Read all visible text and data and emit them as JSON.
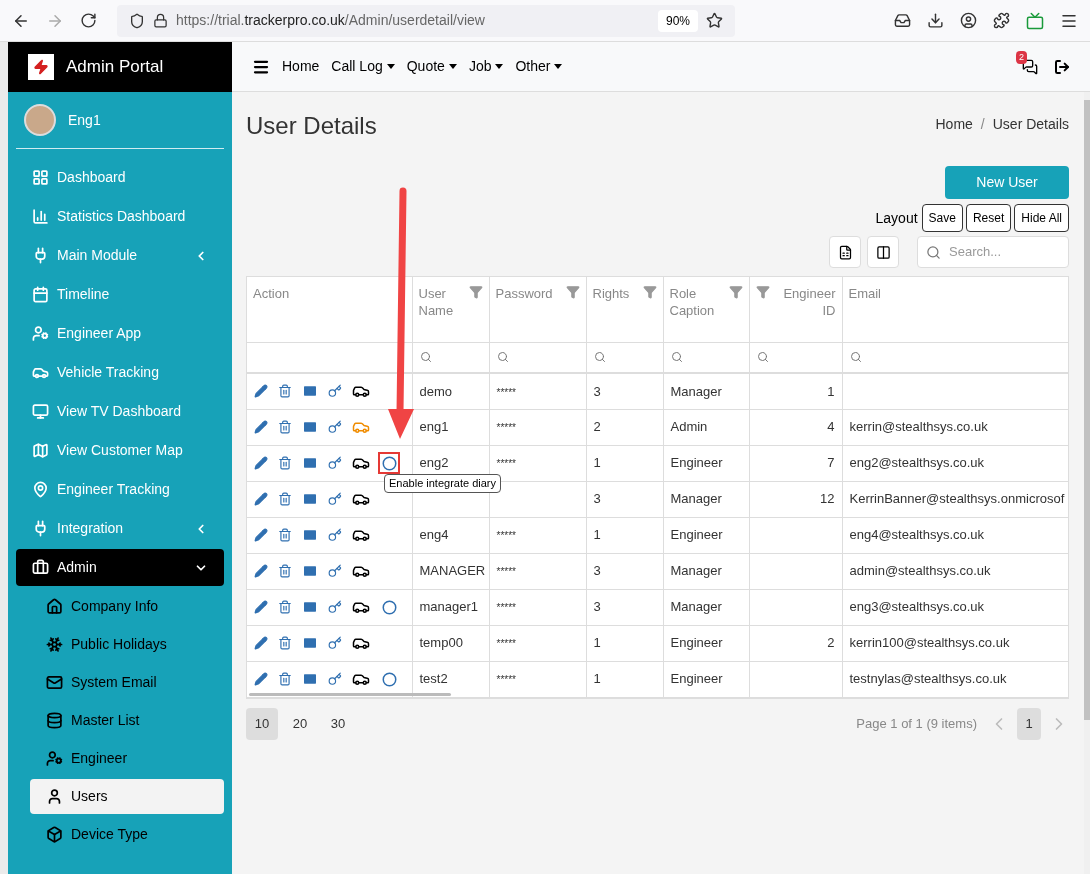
{
  "browser": {
    "url_prefix": "https://trial.",
    "url_domain": "trackerpro.co.uk",
    "url_path": "/Admin/userdetail/view",
    "zoom": "90%"
  },
  "brand": {
    "title": "Admin Portal"
  },
  "user": {
    "name": "Eng1"
  },
  "top_nav": [
    {
      "label": "Home",
      "dropdown": false
    },
    {
      "label": "Call Log",
      "dropdown": true
    },
    {
      "label": "Quote",
      "dropdown": true
    },
    {
      "label": "Job",
      "dropdown": true
    },
    {
      "label": "Other",
      "dropdown": true
    }
  ],
  "notifications": {
    "count": "2"
  },
  "sidebar": {
    "items": [
      {
        "label": "Dashboard",
        "expandable": false,
        "selected": false
      },
      {
        "label": "Statistics Dashboard",
        "expandable": false,
        "selected": false
      },
      {
        "label": "Main Module",
        "expandable": true,
        "expanded": false,
        "selected": false
      },
      {
        "label": "Timeline",
        "expandable": false,
        "selected": false
      },
      {
        "label": "Engineer App",
        "expandable": false,
        "selected": false
      },
      {
        "label": "Vehicle Tracking",
        "expandable": false,
        "selected": false
      },
      {
        "label": "View TV Dashboard",
        "expandable": false,
        "selected": false
      },
      {
        "label": "View Customer Map",
        "expandable": false,
        "selected": false
      },
      {
        "label": "Engineer Tracking",
        "expandable": false,
        "selected": false
      },
      {
        "label": "Integration",
        "expandable": true,
        "expanded": false,
        "selected": false
      },
      {
        "label": "Admin",
        "expandable": true,
        "expanded": true,
        "selected": true,
        "children": [
          {
            "label": "Company Info",
            "selected": false
          },
          {
            "label": "Public Holidays",
            "selected": false
          },
          {
            "label": "System Email",
            "selected": false
          },
          {
            "label": "Master List",
            "selected": false
          },
          {
            "label": "Engineer",
            "selected": false
          },
          {
            "label": "Users",
            "selected": true
          },
          {
            "label": "Device Type",
            "selected": false
          }
        ]
      }
    ]
  },
  "page": {
    "title": "User Details",
    "breadcrumb": [
      "Home",
      "User Details"
    ],
    "breadcrumb_separator": "/"
  },
  "toolbar": {
    "new_button": "New User",
    "layout_label": "Layout",
    "layout_buttons": [
      "Save",
      "Reset",
      "Hide All"
    ],
    "search_placeholder": "Search..."
  },
  "table": {
    "columns": [
      {
        "label": "Action",
        "kind": "action"
      },
      {
        "label": "User Name",
        "kind": "filtered"
      },
      {
        "label": "Password",
        "kind": "filtered"
      },
      {
        "label": "Rights",
        "kind": "filtered"
      },
      {
        "label": "Role Caption",
        "kind": "filtered"
      },
      {
        "label": "Engineer ID",
        "kind": "numeric"
      },
      {
        "label": "Email",
        "kind": "plain"
      }
    ],
    "rows": [
      {
        "user_name": "demo",
        "password": "*****",
        "rights": "3",
        "role_caption": "Manager",
        "engineer_id": "1",
        "tracking_active": false,
        "diary_toggle": false,
        "highlighted": false
      },
      {
        "user_name": "eng1",
        "password": "*****",
        "rights": "2",
        "role_caption": "Admin",
        "engineer_id": "4",
        "email": "kerrin@stealthsys.co.uk",
        "tracking_active": true,
        "diary_toggle": false,
        "highlighted": false
      },
      {
        "user_name": "eng2",
        "password": "*****",
        "rights": "1",
        "role_caption": "Engineer",
        "engineer_id": "7",
        "email": "eng2@stealthsys.co.uk",
        "tracking_active": false,
        "diary_toggle": true,
        "highlighted": true,
        "tooltip": "Enable integrate diary"
      },
      {
        "rights": "3",
        "role_caption": "Manager",
        "engineer_id": "12",
        "email": "KerrinBanner@stealthsys.onmicrosof",
        "tracking_active": false,
        "diary_toggle": false,
        "highlighted": false
      },
      {
        "user_name": "eng4",
        "password": "*****",
        "rights": "1",
        "role_caption": "Engineer",
        "email": "eng4@stealthsys.co.uk",
        "tracking_active": false,
        "diary_toggle": false,
        "highlighted": false
      },
      {
        "user_name": "MANAGER",
        "password": "*****",
        "rights": "3",
        "role_caption": "Manager",
        "email": "admin@stealthsys.co.uk",
        "tracking_active": false,
        "diary_toggle": false,
        "highlighted": false
      },
      {
        "user_name": "manager1",
        "password": "*****",
        "rights": "3",
        "role_caption": "Manager",
        "email": "eng3@stealthsys.co.uk",
        "tracking_active": false,
        "diary_toggle": true,
        "highlighted": false
      },
      {
        "user_name": "temp00",
        "password": "*****",
        "rights": "1",
        "role_caption": "Engineer",
        "engineer_id": "2",
        "email": "kerrin100@stealthsys.co.uk",
        "tracking_active": false,
        "diary_toggle": false,
        "highlighted": false
      },
      {
        "user_name": "test2",
        "password": "*****",
        "rights": "1",
        "role_caption": "Engineer",
        "email": "testnylas@stealthsys.co.uk",
        "tracking_active": false,
        "diary_toggle": true,
        "highlighted": false
      }
    ]
  },
  "pager": {
    "sizes": [
      {
        "label": "10",
        "selected": true
      },
      {
        "label": "20",
        "selected": false
      },
      {
        "label": "30",
        "selected": false
      }
    ],
    "info": "Page 1 of 1 (9 items)",
    "pages": [
      {
        "label": "1",
        "selected": true
      }
    ]
  }
}
